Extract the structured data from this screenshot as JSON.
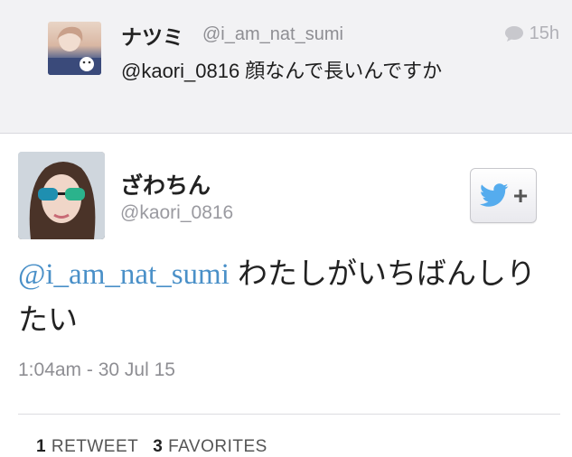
{
  "reply": {
    "name": "ナツミ",
    "handle": "@i_am_nat_sumi",
    "time": "15h",
    "text": "@kaori_0816 顔なんで長いんですか"
  },
  "tweet": {
    "name": "ざわちん",
    "handle": "@kaori_0816",
    "mention": "@i_am_nat_sumi",
    "text": " わたしがいちばんしりたい",
    "timestamp": "1:04am - 30 Jul 15",
    "retweets_count": "1",
    "retweets_label": "RETWEET",
    "favorites_count": "3",
    "favorites_label": "FAVORITES"
  },
  "colors": {
    "twitter_blue": "#55acee",
    "mention": "#4a90c8"
  },
  "icons": {
    "reply_icon": "speech-bubble",
    "follow_icon": "twitter-bird-plus"
  }
}
